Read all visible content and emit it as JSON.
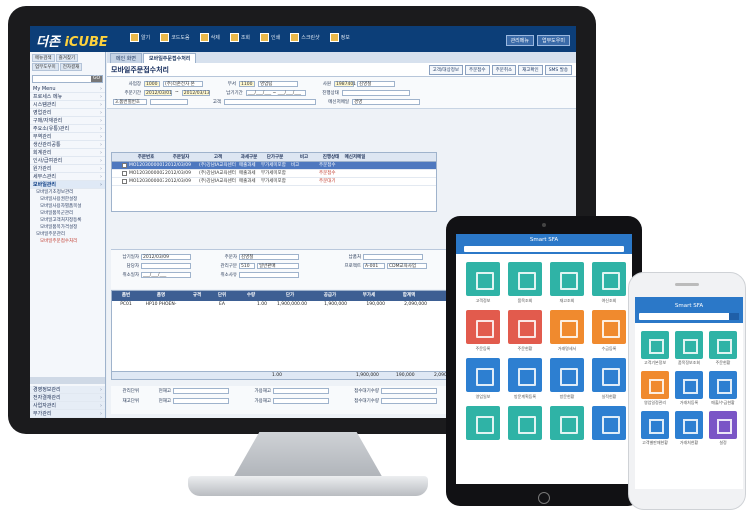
{
  "app": {
    "brand_prefix": "더존",
    "brand_main": "iCUBE",
    "top_menus": [
      "알기",
      "코드도움",
      "삭제",
      "조회",
      "인쇄",
      "스크린샷",
      "정보"
    ],
    "top_right_buttons": [
      "관리메뉴",
      "업무도우미"
    ]
  },
  "sidebar": {
    "top_buttons": [
      "메뉴검색",
      "즐겨찾기",
      "업무도우미",
      "전자결재"
    ],
    "search_button": "GO",
    "items": [
      "My Menu",
      "프로세스 메뉴",
      "시스템관리",
      "영업관리",
      "구매/자재관리",
      "주요소(유통)관리",
      "무역관리",
      "생산관리공통",
      "회계관리",
      "인사/급여관리",
      "원가관리",
      "세무스관리",
      "모바일관리"
    ],
    "sub_items": [
      "모바일기초정보관리",
      "모바일사용권한설정",
      "모바일사용자별품목설",
      "모바일품목군관리",
      "모바일고객처지정등록",
      "모바일품목가격설정",
      "모바일주문관리",
      "모바일주문접수처리"
    ],
    "bottom_items": [
      "경영정보관리",
      "전자결재관리",
      "사업자관리",
      "부가관리"
    ]
  },
  "main": {
    "tabs": [
      "메인 화면",
      "모바일주문접수처리"
    ],
    "title": "모바일주문접수처리",
    "actions": [
      "고객/대상정보",
      "주문접수",
      "주문취소",
      "재고확인",
      "SMS 발송"
    ],
    "filters": {
      "company_label": "사업장",
      "company_code": "1000",
      "company_name": "(주)더존전자 본",
      "dept_label": "부서",
      "dept_code": "1100",
      "dept_name": "영업팀",
      "emp_label": "사원",
      "emp_code": "1987401",
      "emp_name": "김영철",
      "period_label": "주문기간",
      "period_from": "2012/03/01",
      "period_to": "2012/03/13",
      "delivery_label": "납기기간",
      "delivery_value": "___/___/___ ~ ___/___/___",
      "status_label": "진행상태",
      "order_type": "3.품번별번호",
      "customer_label": "고객",
      "message_label": "메신저메일",
      "message_value": "경영"
    },
    "grid": {
      "headers": [
        "",
        "",
        "주문번호",
        "주문일자",
        "고객",
        "과세구분",
        "단가구분",
        "비고",
        "진행상태",
        "메신저메일"
      ],
      "rows": [
        [
          "MO1203000001",
          "2012/03/09",
          "(주)강남IA교육센터",
          "매출과세",
          "부가세미포함",
          "비고",
          "주문접수"
        ],
        [
          "MO1203000002",
          "2012/03/09",
          "(주)강남IA교육센터",
          "매출과세",
          "부가세미포함",
          "",
          "주문접수"
        ],
        [
          "MO1203000003",
          "2012/03/09",
          "(주)강남IA교육센터",
          "매출과세",
          "부가세미포함",
          "",
          "주문대기"
        ]
      ]
    },
    "detail": {
      "delivery_date_label": "납기일자",
      "delivery_date": "2012/03/09",
      "owner_label": "담당자",
      "cancel_date_label": "취소일자",
      "cancel_date": "___/___/___",
      "orderer_label": "주문자",
      "orderer": "김영철",
      "manage_label": "관리구분",
      "manage_code": "510",
      "manage_name": "일반판매",
      "cancel_reason_label": "취소사유",
      "deliverer_label": "납품처",
      "project_label": "프로젝트",
      "project_code": "A-001",
      "project_name": "CDM교육사업"
    },
    "lines": {
      "headers": [
        "품번",
        "품명",
        "규격",
        "단위",
        "수량",
        "단가",
        "공급가",
        "부가세",
        "합계액"
      ],
      "row": [
        "PC01",
        "HP10 PHOEN-",
        "",
        "EA",
        "1.00",
        "1,900,000.00",
        "1,900,000",
        "190,000",
        "2,090,000"
      ],
      "totals": [
        "1.00",
        "1,900,000",
        "190,000",
        "2,090,000"
      ]
    },
    "footer": {
      "unit1_label": "관리단위",
      "stock1_label": "현재고",
      "avail1_label": "가용재고",
      "wait1_label": "접수대기수량",
      "unit2_label": "재고단위",
      "stock2_label": "현재고",
      "avail2_label": "가용재고",
      "wait2_label": "접수대기수량"
    }
  },
  "tablet": {
    "title": "Smart SFA",
    "tiles": [
      {
        "label": "고객정보",
        "color": "#2fb3a6"
      },
      {
        "label": "품목조회",
        "color": "#2fb3a6"
      },
      {
        "label": "재고조회",
        "color": "#2fb3a6"
      },
      {
        "label": "여신조회",
        "color": "#2fb3a6"
      },
      {
        "label": "주문등록",
        "color": "#e25b4d"
      },
      {
        "label": "주문현황",
        "color": "#e25b4d"
      },
      {
        "label": "거래명세서",
        "color": "#f08a2e"
      },
      {
        "label": "수금등록",
        "color": "#f08a2e"
      },
      {
        "label": "영업일보",
        "color": "#2d7fd1"
      },
      {
        "label": "방문계획등록",
        "color": "#2d7fd1"
      },
      {
        "label": "방문현황",
        "color": "#2d7fd1"
      },
      {
        "label": "실적현황",
        "color": "#2d7fd1"
      },
      {
        "label": "",
        "color": "#2fb3a6"
      },
      {
        "label": "",
        "color": "#2fb3a6"
      },
      {
        "label": "",
        "color": "#2fb3a6"
      },
      {
        "label": "",
        "color": "#2d7fd1"
      }
    ]
  },
  "phone": {
    "title": "Smart SFA",
    "tiles": [
      {
        "label": "고객기본정보",
        "color": "#2fb3a6"
      },
      {
        "label": "품목정보조회",
        "color": "#2fb3a6"
      },
      {
        "label": "주문현황",
        "color": "#2fb3a6"
      },
      {
        "label": "영업일정관리",
        "color": "#f08a2e"
      },
      {
        "label": "거래처등록",
        "color": "#2d7fd1"
      },
      {
        "label": "매출/수금현황",
        "color": "#2d7fd1"
      },
      {
        "label": "고객별판매현황",
        "color": "#2d7fd1"
      },
      {
        "label": "거래처현황",
        "color": "#2d7fd1"
      },
      {
        "label": "설정",
        "color": "#7a55c6"
      }
    ]
  }
}
